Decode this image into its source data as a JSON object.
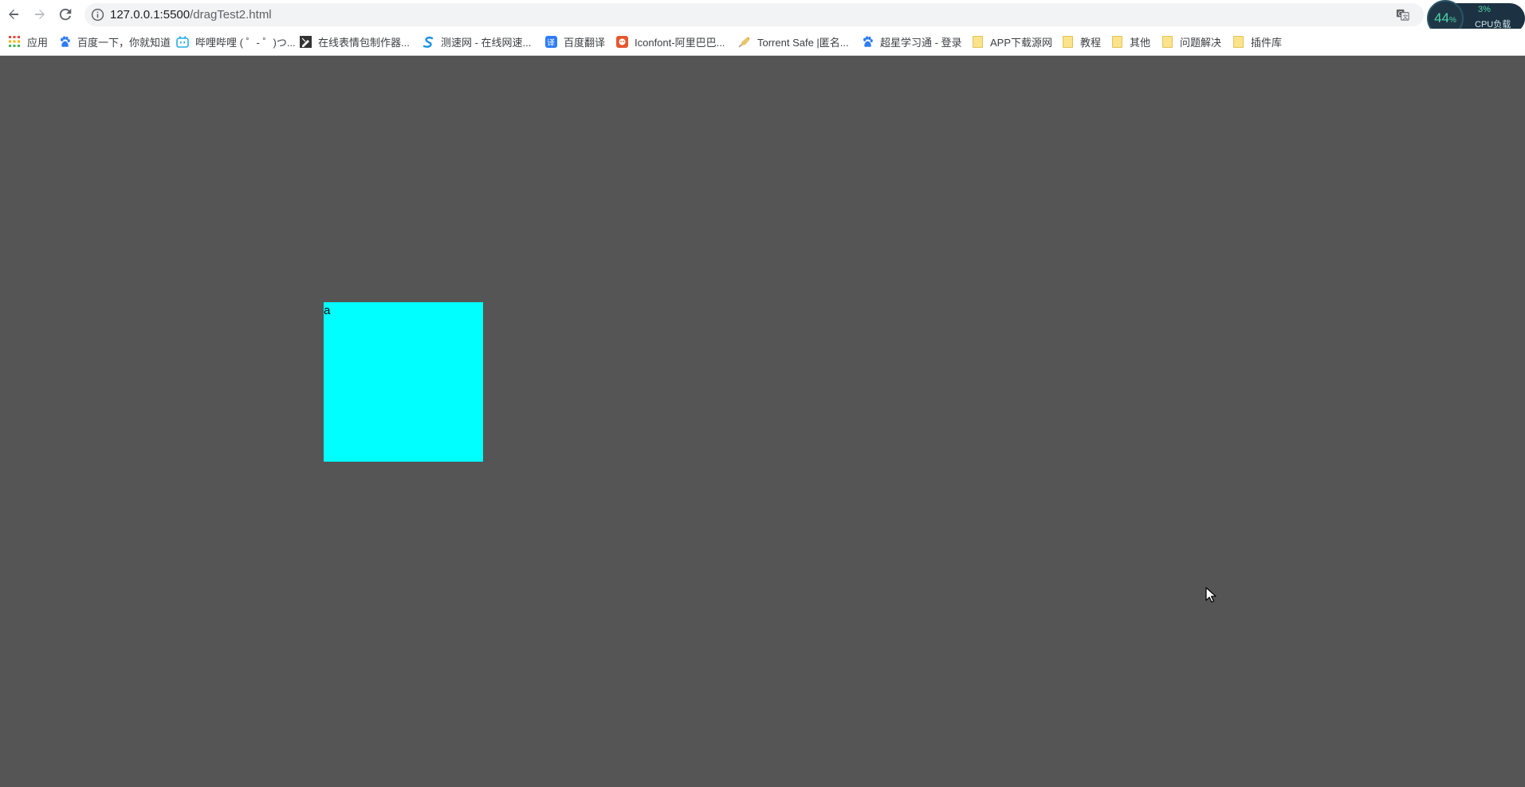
{
  "browser": {
    "url_host": "127.0.0.1:5500",
    "url_path": "/dragTest2.html",
    "nav": {
      "back": "back-arrow-icon",
      "forward": "forward-arrow-icon",
      "reload": "reload-icon"
    }
  },
  "bookmarks": [
    {
      "label": "应用",
      "icon": "apps-grid-icon",
      "color": "#e8453c"
    },
    {
      "label": "百度一下，你就知道",
      "icon": "baidu-paw-icon",
      "color": "#2d7cf6"
    },
    {
      "label": "哔哩哔哩 ( ゜- ゜)つ...",
      "icon": "bilibili-tv-icon",
      "color": "#23ade5"
    },
    {
      "label": "在线表情包制作器...",
      "icon": "pencil-tile-icon",
      "color": "#333333"
    },
    {
      "label": "测速网 - 在线网速...",
      "icon": "s-swoosh-icon",
      "color": "#1a8fe8"
    },
    {
      "label": "百度翻译",
      "icon": "translate-icon",
      "color": "#2d7cf6"
    },
    {
      "label": "Iconfont-阿里巴巴...",
      "icon": "iconfont-icon",
      "color": "#e4572e"
    },
    {
      "label": "Torrent Safe |匿名...",
      "icon": "rocket-icon",
      "color": "#e2a23b"
    },
    {
      "label": "超星学习通 - 登录",
      "icon": "baidu-paw-icon",
      "color": "#2d7cf6"
    },
    {
      "label": "APP下载源网",
      "icon": "folder-icon",
      "color": "#fbe38c"
    },
    {
      "label": "教程",
      "icon": "folder-icon",
      "color": "#fbe38c"
    },
    {
      "label": "其他",
      "icon": "folder-icon",
      "color": "#fbe38c"
    },
    {
      "label": "问题解决",
      "icon": "folder-icon",
      "color": "#fbe38c"
    },
    {
      "label": "插件库",
      "icon": "folder-icon",
      "color": "#fbe38c"
    }
  ],
  "cpu_widget": {
    "main_value": "44",
    "main_unit": "%",
    "secondary": "3%",
    "label": "CPU负载",
    "accent": "#4fd5a9"
  },
  "page": {
    "background": "#555555",
    "drag_box": {
      "text": "a",
      "color": "#00ffff"
    }
  }
}
